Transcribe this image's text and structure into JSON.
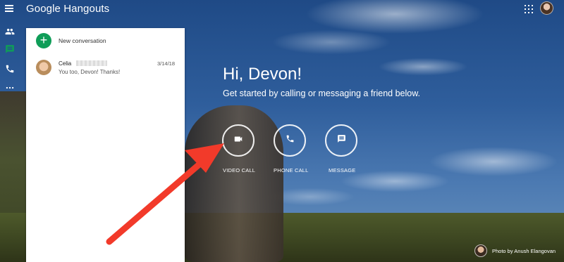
{
  "app": {
    "title": "Google Hangouts"
  },
  "sidebar": {
    "items": [
      {
        "name": "contacts",
        "icon": "people-icon"
      },
      {
        "name": "messages",
        "icon": "chat-icon"
      },
      {
        "name": "phone",
        "icon": "phone-icon"
      },
      {
        "name": "more",
        "icon": "more-horiz-icon"
      }
    ]
  },
  "conversations": {
    "new_label": "New conversation",
    "items": [
      {
        "name": "Celia",
        "date": "3/14/18",
        "preview": "You too, Devon! Thanks!"
      }
    ]
  },
  "main": {
    "greeting": "Hi, Devon!",
    "subtitle": "Get started by calling or messaging a friend below.",
    "actions": [
      {
        "label": "VIDEO CALL",
        "icon": "videocam-icon"
      },
      {
        "label": "PHONE CALL",
        "icon": "phone-icon"
      },
      {
        "label": "MESSAGE",
        "icon": "message-icon"
      }
    ]
  },
  "credit": {
    "text": "Photo by Anush Elangovan"
  },
  "colors": {
    "accent_green": "#0f9d58",
    "annotation_arrow": "#f23a2a"
  }
}
